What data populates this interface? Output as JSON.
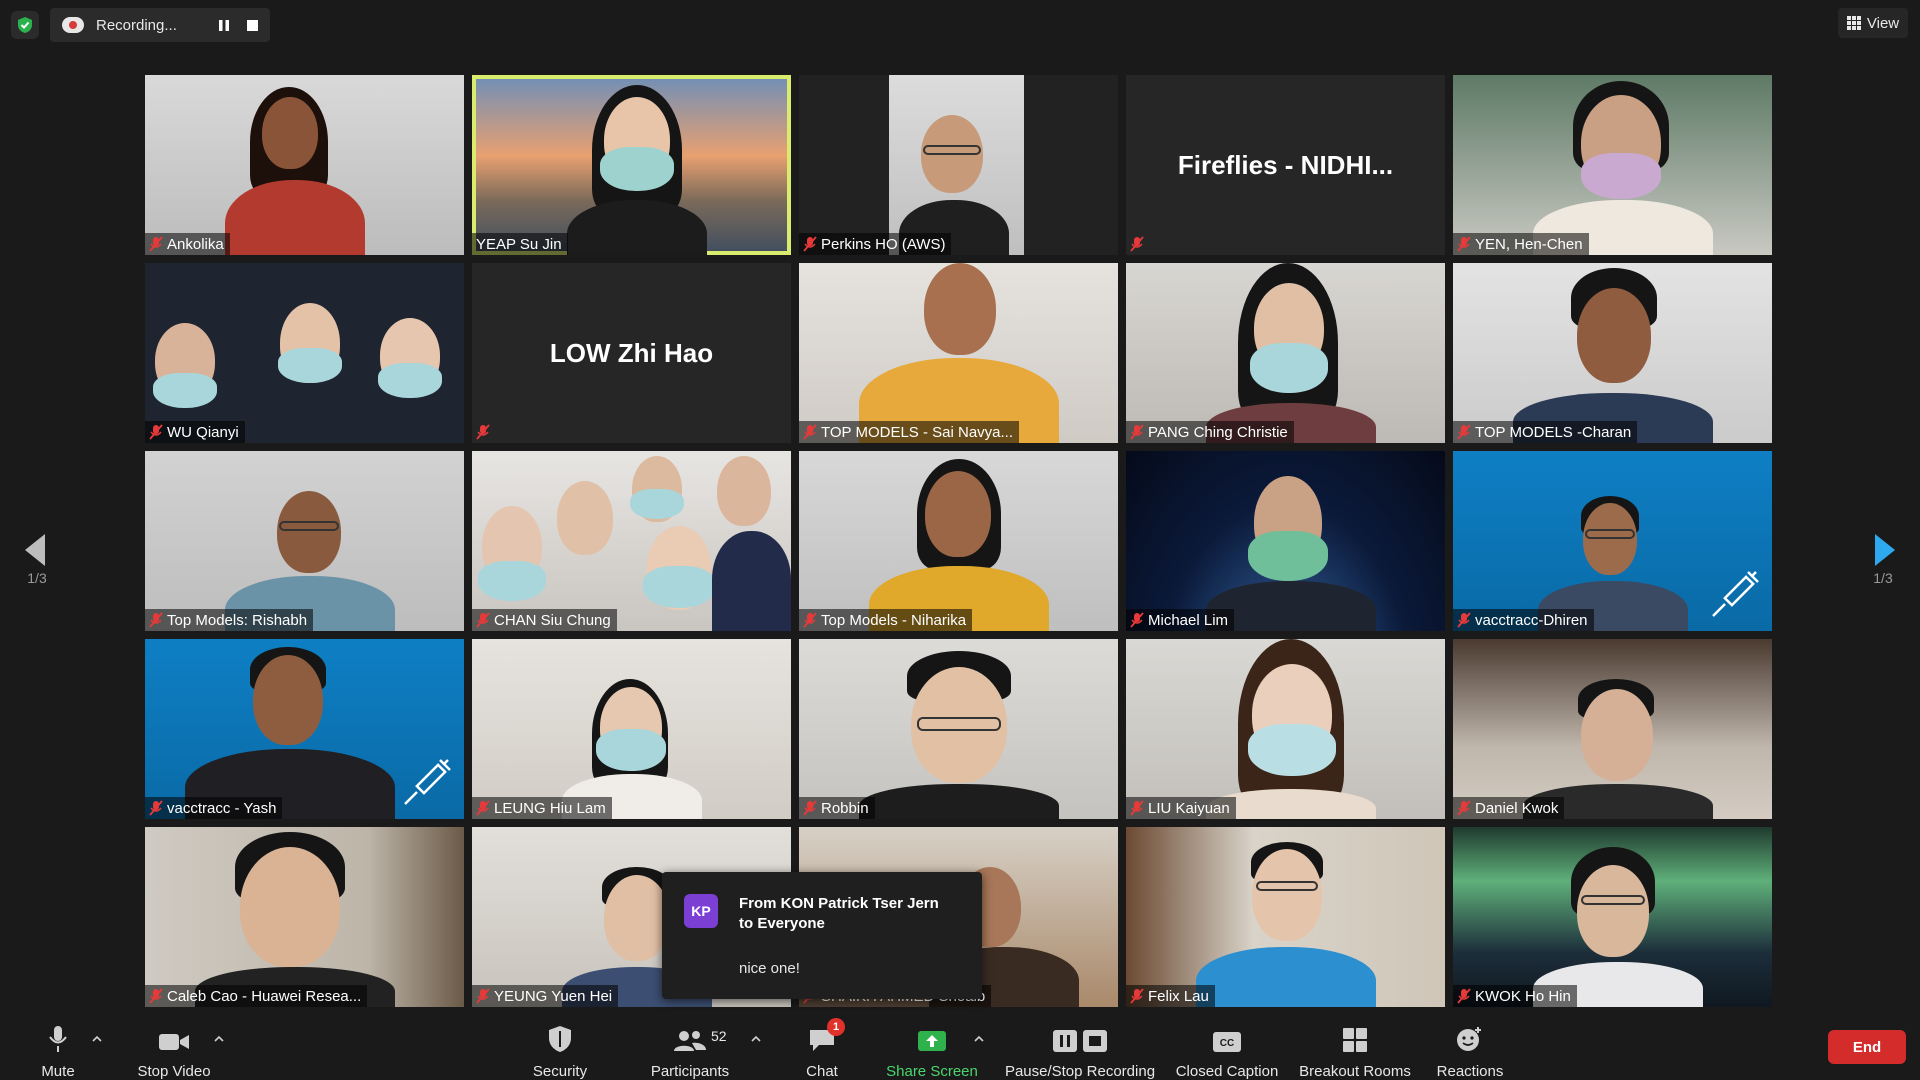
{
  "topbar": {
    "recording_label": "Recording...",
    "view_label": "View"
  },
  "nav": {
    "page_left": "1/3",
    "page_right": "1/3"
  },
  "participants": [
    {
      "name": "Ankolika",
      "muted": true
    },
    {
      "name": "YEAP Su Jin",
      "muted": false,
      "active_speaker": true
    },
    {
      "name": "Perkins HO (AWS)",
      "muted": true
    },
    {
      "name": "Fireflies - NIDHI...",
      "muted": true,
      "video": false
    },
    {
      "name": "YEN, Hen-Chen",
      "muted": true
    },
    {
      "name": "WU Qianyi",
      "muted": true
    },
    {
      "name": "LOW Zhi Hao",
      "muted": true,
      "video": false
    },
    {
      "name": "TOP MODELS - Sai Navya...",
      "muted": true
    },
    {
      "name": "PANG Ching Christie",
      "muted": true
    },
    {
      "name": "TOP MODELS -Charan",
      "muted": true
    },
    {
      "name": "Top Models: Rishabh",
      "muted": true
    },
    {
      "name": "CHAN  Siu Chung",
      "muted": true
    },
    {
      "name": "Top Models - Niharika",
      "muted": true
    },
    {
      "name": "Michael Lim",
      "muted": true
    },
    {
      "name": "vacctracc-Dhiren",
      "muted": true
    },
    {
      "name": "vacctracc - Yash",
      "muted": true
    },
    {
      "name": "LEUNG Hiu Lam",
      "muted": true
    },
    {
      "name": "Robbin",
      "muted": true
    },
    {
      "name": "LIU Kaiyuan",
      "muted": true
    },
    {
      "name": "Daniel Kwok",
      "muted": true
    },
    {
      "name": "Caleb Cao - Huawei Resea...",
      "muted": true
    },
    {
      "name": "YEUNG Yuen Hei",
      "muted": true
    },
    {
      "name": "SHAIKH AHMED Shoaib",
      "muted": true
    },
    {
      "name": "Felix Lau",
      "muted": true
    },
    {
      "name": "KWOK Ho Hin",
      "muted": true
    }
  ],
  "chat_toast": {
    "avatar_initials": "KP",
    "from_line": "From KON Patrick Tser Jern",
    "to_line": "to Everyone",
    "message": "nice one!"
  },
  "toolbar": {
    "mute": "Mute",
    "stop_video": "Stop Video",
    "security": "Security",
    "participants": "Participants",
    "participants_count": "52",
    "chat": "Chat",
    "chat_badge": "1",
    "share_screen": "Share Screen",
    "pause_stop_recording": "Pause/Stop Recording",
    "closed_caption": "Closed Caption",
    "breakout_rooms": "Breakout Rooms",
    "reactions": "Reactions",
    "end": "End"
  },
  "colors": {
    "background": "#1a1a1a",
    "active_speaker_border": "#d9ec6e",
    "share_green": "#4ad66d",
    "end_red": "#d42b2b",
    "badge_red": "#e0312b",
    "nav_arrow_blue": "#2ea8ee"
  },
  "icons": [
    "shield-icon",
    "record-icon",
    "pause-icon",
    "stop-icon",
    "grid-icon",
    "chevron-left-icon",
    "chevron-right-icon",
    "mic-muted-icon",
    "mic-icon",
    "video-camera-icon",
    "security-shield-icon",
    "participants-icon",
    "chat-icon",
    "share-screen-icon",
    "pause-stop-recording-icon",
    "closed-caption-icon",
    "breakout-rooms-icon",
    "reactions-icon",
    "caret-up-icon"
  ]
}
